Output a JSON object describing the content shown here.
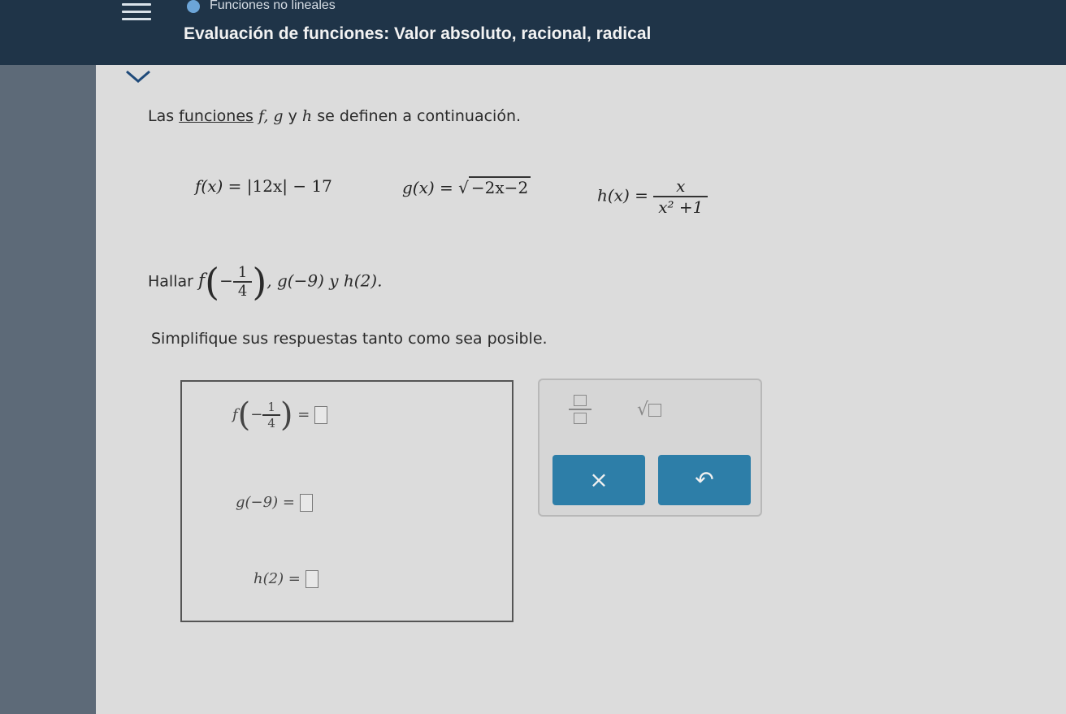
{
  "header": {
    "breadcrumb": "Funciones no lineales",
    "title": "Evaluación de funciones: Valor absoluto, racional, radical"
  },
  "problem": {
    "intro_prefix": "Las ",
    "intro_link": "funciones",
    "intro_funcs": " f, g",
    "intro_y": " y ",
    "intro_h": "h",
    "intro_suffix": " se definen a continuación.",
    "f_def_lhs": "f(x) = ",
    "f_def_rhs": "|12x| − 17",
    "g_def_lhs": "g(x) = ",
    "g_def_radicand": "−2x−2",
    "h_def_lhs": "h(x) = ",
    "h_def_num": "x",
    "h_def_den": "x² +1",
    "find_label": "Hallar ",
    "find_f": "f",
    "find_f_num": "1",
    "find_f_den": "4",
    "find_rest": ", g(−9) y h(2).",
    "simplify": "Simplifique sus respuestas tanto como sea posible."
  },
  "answers": {
    "f_label": "f",
    "f_num": "1",
    "f_den": "4",
    "g_label": "g(−9) =",
    "h_label": "h(2) ="
  },
  "keypad": {
    "clear_symbol": "×",
    "undo_symbol": "↶"
  },
  "colors": {
    "header_bg": "#1f3448",
    "button_bg": "#2d7ea8"
  }
}
